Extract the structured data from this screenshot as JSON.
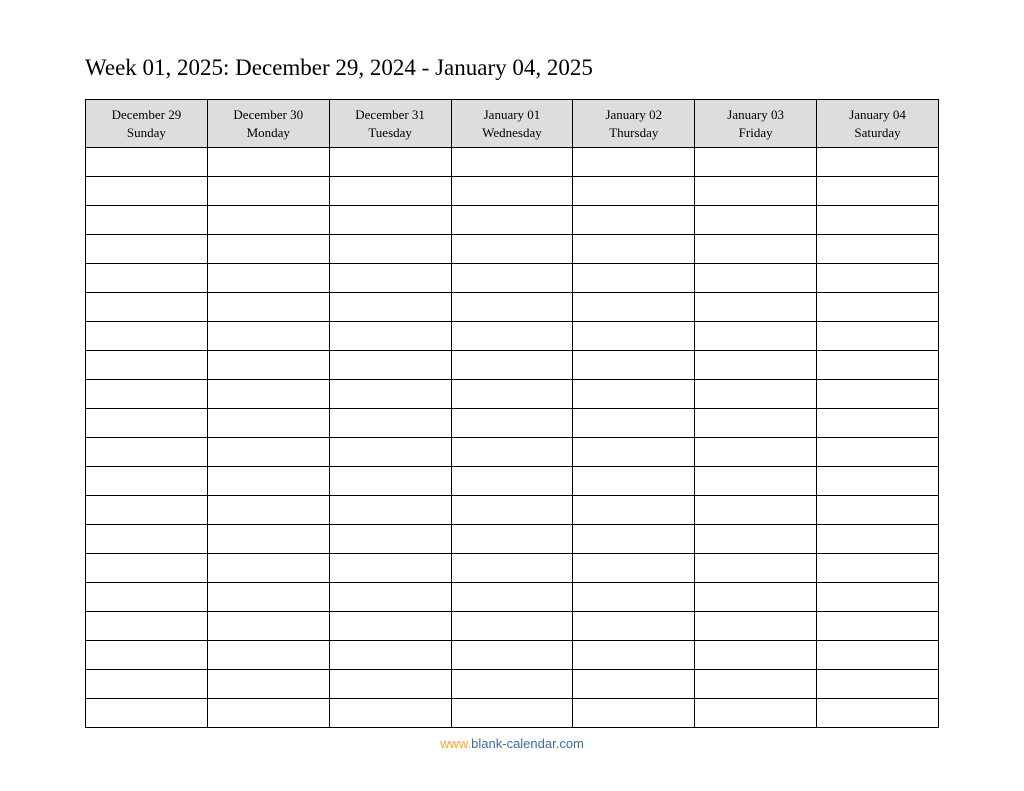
{
  "title": "Week 01, 2025: December 29, 2024 - January 04, 2025",
  "days": [
    {
      "date": "December 29",
      "weekday": "Sunday"
    },
    {
      "date": "December 30",
      "weekday": "Monday"
    },
    {
      "date": "December 31",
      "weekday": "Tuesday"
    },
    {
      "date": "January 01",
      "weekday": "Wednesday"
    },
    {
      "date": "January 02",
      "weekday": "Thursday"
    },
    {
      "date": "January 03",
      "weekday": "Friday"
    },
    {
      "date": "January 04",
      "weekday": "Saturday"
    }
  ],
  "row_count": 20,
  "footer": {
    "prefix": "www.",
    "domain": "blank-calendar.com"
  }
}
